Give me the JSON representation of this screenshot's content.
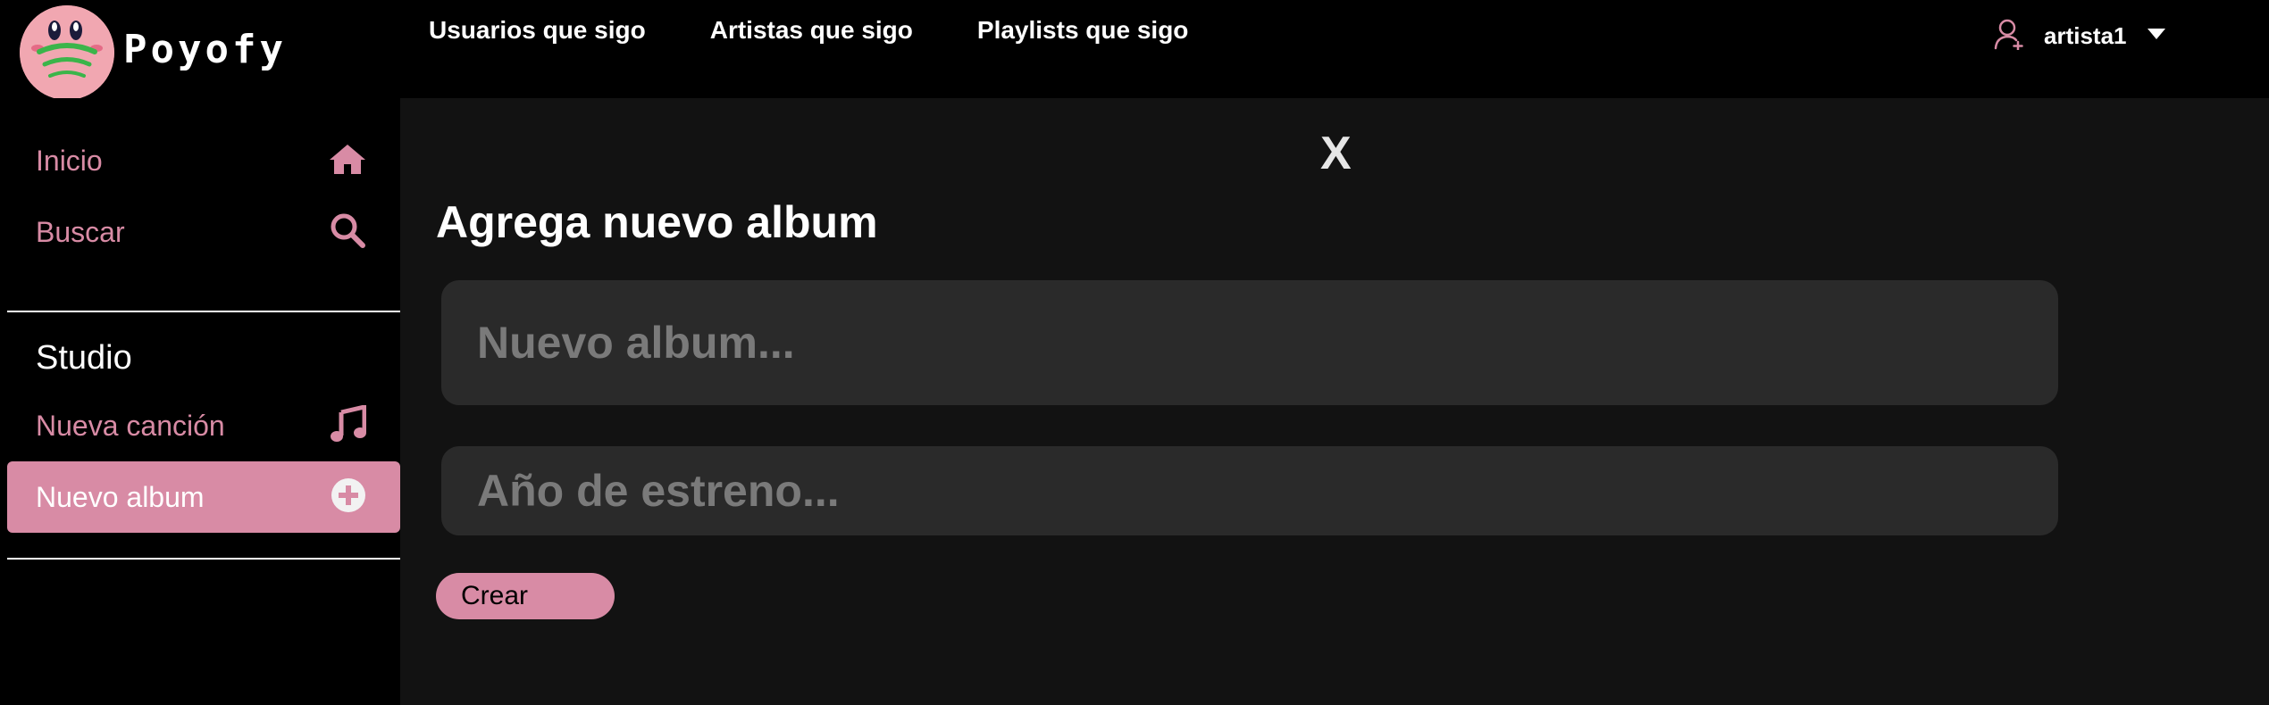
{
  "brand": {
    "name": "Poyofy",
    "logo_icon": "kirby-logo-icon"
  },
  "topnav": {
    "items": [
      {
        "label": "Usuarios que sigo"
      },
      {
        "label": "Artistas que sigo"
      },
      {
        "label": "Playlists que sigo"
      }
    ]
  },
  "user": {
    "icon": "user-icon",
    "name": "artista1",
    "dropdown_icon": "caret-down-icon"
  },
  "sidebar": {
    "items": [
      {
        "label": "Inicio",
        "icon": "home-icon"
      },
      {
        "label": "Buscar",
        "icon": "search-icon"
      }
    ],
    "studio": {
      "title": "Studio",
      "items": [
        {
          "label": "Nueva canción",
          "icon": "music-note-icon"
        },
        {
          "label": "Nuevo album",
          "icon": "plus-circle-icon",
          "active": true
        }
      ]
    }
  },
  "form": {
    "close_label": "X",
    "title": "Agrega nuevo album",
    "album_placeholder": "Nuevo album...",
    "album_value": "",
    "year_placeholder": "Año de estreno...",
    "year_value": "",
    "submit_label": "Crear"
  },
  "colors": {
    "accent": "#d88ba5",
    "background": "#000000",
    "panel": "#121212",
    "input": "#2a2a2a"
  }
}
